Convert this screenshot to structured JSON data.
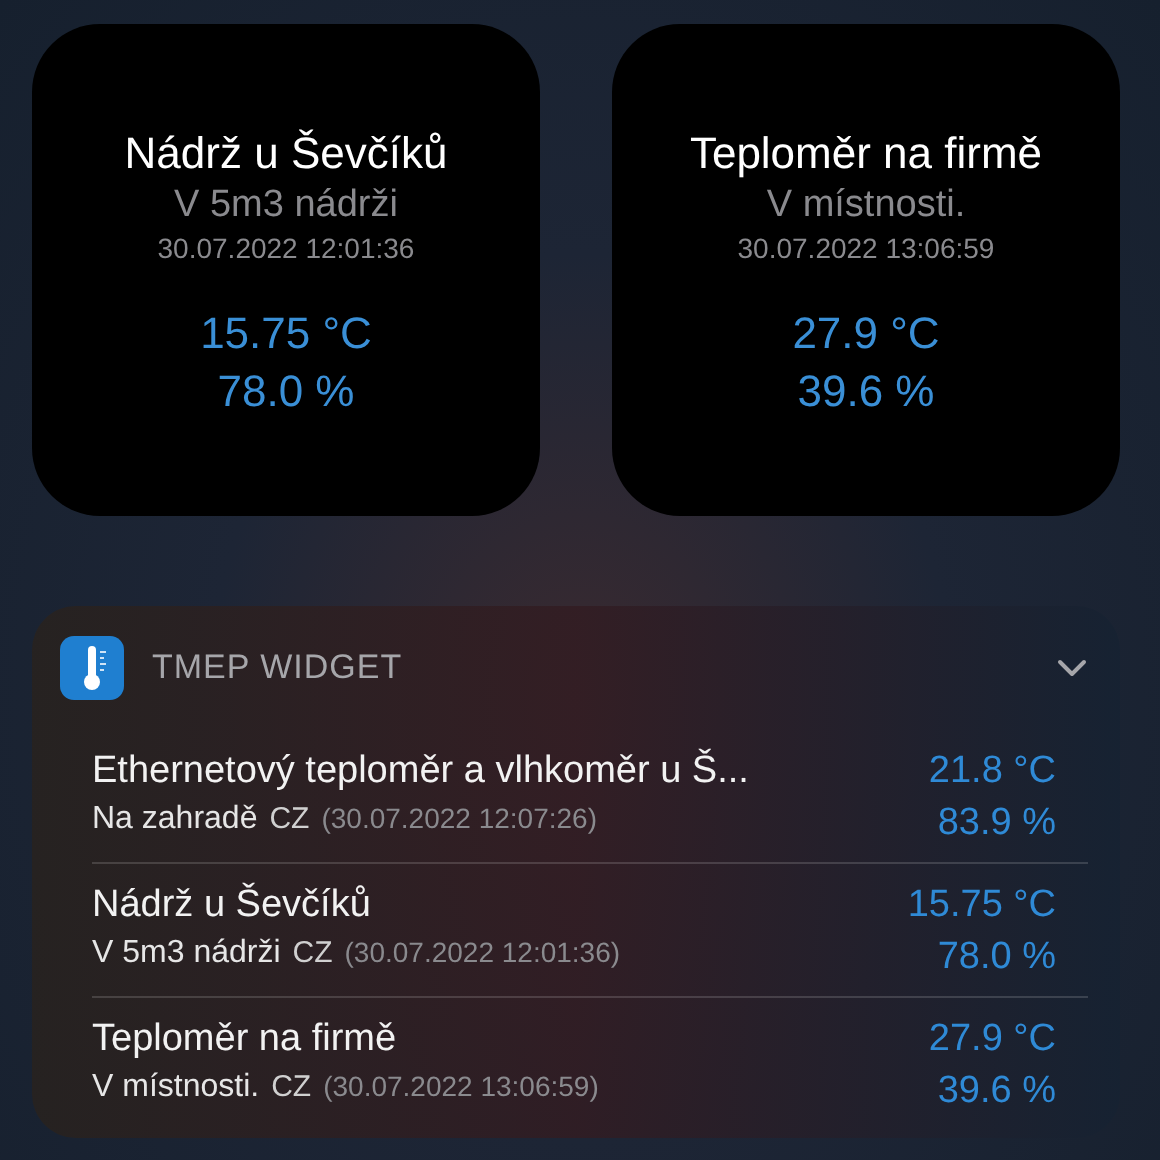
{
  "tiles": [
    {
      "title": "Nádrž u Ševčíků",
      "subtitle": "V 5m3 nádrži",
      "time": "30.07.2022 12:01:36",
      "temperature": "15.75 °C",
      "humidity": "78.0 %"
    },
    {
      "title": "Teploměr na firmě",
      "subtitle": "V místnosti.",
      "time": "30.07.2022 13:06:59",
      "temperature": "27.9 °C",
      "humidity": "39.6 %"
    }
  ],
  "widget": {
    "title": "TMEP WIDGET",
    "expanded": false,
    "rows": [
      {
        "name": "Ethernetový teploměr a vlhkoměr u Š...",
        "place": "Na zahradě",
        "country": "CZ",
        "time": "(30.07.2022 12:07:26)",
        "temperature": "21.8 °C",
        "humidity": "83.9 %"
      },
      {
        "name": "Nádrž u Ševčíků",
        "place": "V 5m3 nádrži",
        "country": "CZ",
        "time": "(30.07.2022 12:01:36)",
        "temperature": "15.75 °C",
        "humidity": "78.0 %"
      },
      {
        "name": "Teploměr na firmě",
        "place": "V místnosti.",
        "country": "CZ",
        "time": "(30.07.2022 13:06:59)",
        "temperature": "27.9 °C",
        "humidity": "39.6 %"
      }
    ]
  }
}
